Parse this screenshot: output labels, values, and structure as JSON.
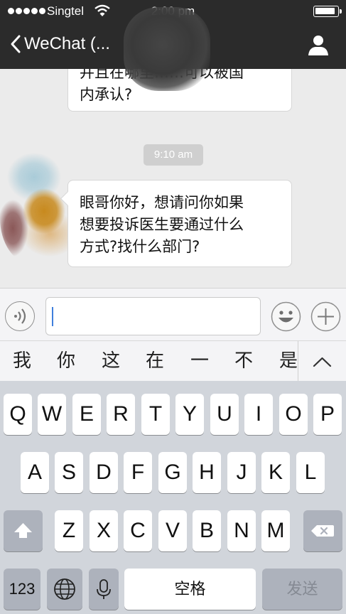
{
  "status_bar": {
    "carrier": "Singtel",
    "time": "2:00 pm"
  },
  "nav": {
    "back_title": "WeChat (..."
  },
  "chat": {
    "messages": [
      {
        "lines": [
          "并且在哪里……可以被国",
          "内承认?"
        ]
      },
      {
        "lines": [
          "眼哥你好，想请问你如果",
          "想要投诉医生要通过什么",
          "方式?找什么部门?"
        ]
      }
    ],
    "timestamp": "9:10 am"
  },
  "input": {
    "value": ""
  },
  "candidates": [
    "我",
    "你",
    "这",
    "在",
    "一",
    "不",
    "是"
  ],
  "keyboard": {
    "row1": [
      "Q",
      "W",
      "E",
      "R",
      "T",
      "Y",
      "U",
      "I",
      "O",
      "P"
    ],
    "row2": [
      "A",
      "S",
      "D",
      "F",
      "G",
      "H",
      "J",
      "K",
      "L"
    ],
    "row3": [
      "Z",
      "X",
      "C",
      "V",
      "B",
      "N",
      "M"
    ],
    "numbers_label": "123",
    "space_label": "空格",
    "send_label": "发送"
  },
  "colors": {
    "nav_bg": "#2b2b2b",
    "chat_bg": "#ebebeb",
    "keyboard_bg": "#d1d5db",
    "caret": "#3f7fdc"
  }
}
